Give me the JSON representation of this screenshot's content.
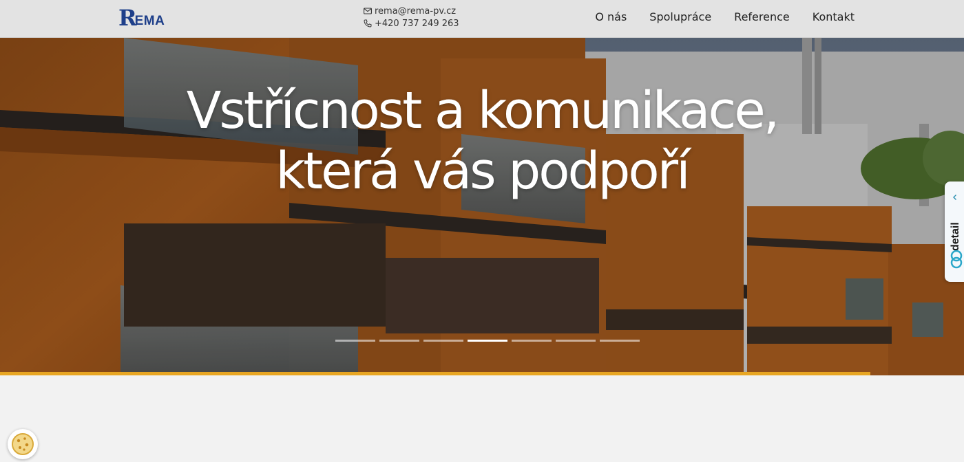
{
  "header": {
    "logo_first": "R",
    "logo_rest": "EMA",
    "logo_alt": "REMA",
    "email": "rema@rema-pv.cz",
    "phone": "+420 737 249 263",
    "nav": [
      {
        "label": "O nás"
      },
      {
        "label": "Spolupráce"
      },
      {
        "label": "Reference"
      },
      {
        "label": "Kontakt"
      }
    ]
  },
  "hero": {
    "title_line1": "Vstřícnost a komunikace,",
    "title_line2": "která vás podpoří",
    "slides_total": 7,
    "active_slide": 4
  },
  "detail_widget": {
    "label": "detail",
    "icons": [
      "chevron-left-icon",
      "detail-logo-icon"
    ]
  },
  "cookie": {
    "icon": "cookie-icon"
  },
  "colors": {
    "brand_blue": "#1e3f8a",
    "accent_gold": "#e8a623",
    "header_bg": "#e3e3e3"
  }
}
